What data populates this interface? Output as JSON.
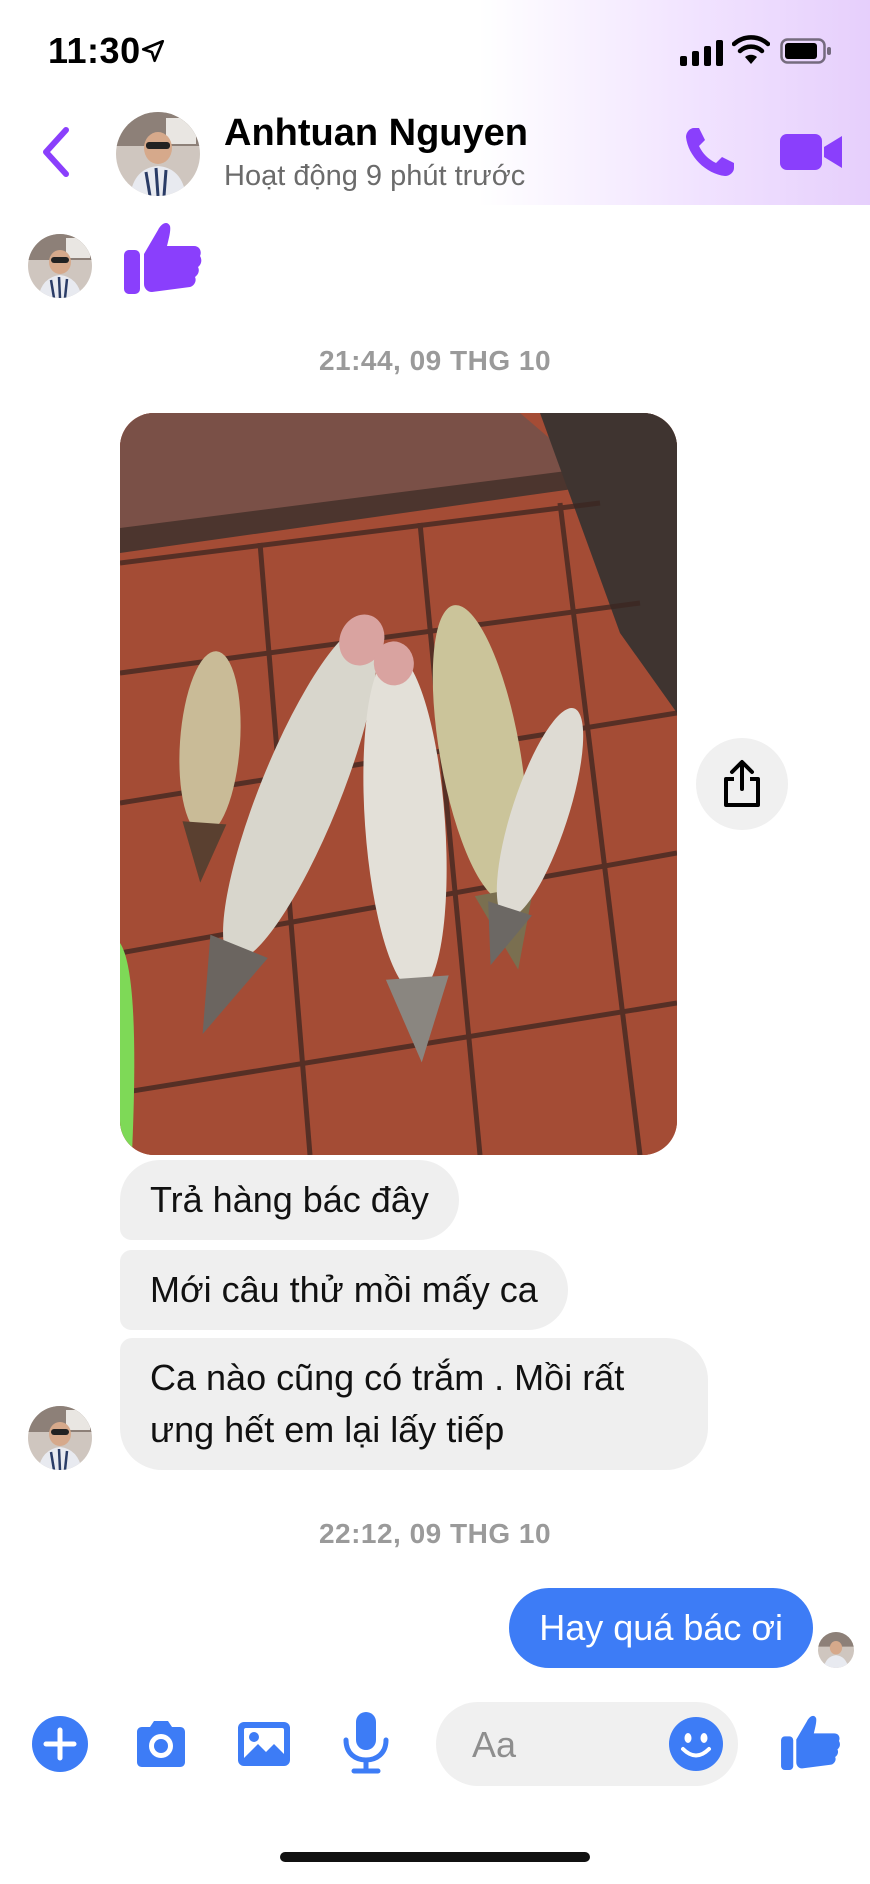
{
  "status_bar": {
    "time": "11:30"
  },
  "header": {
    "name": "Anhtuan Nguyen",
    "status": "Hoạt động 9 phút trước"
  },
  "messages": {
    "timestamp_1": "21:44, 09 THG 10",
    "incoming": [
      "Trả hàng bác đây",
      "Mới câu thử mồi mấy ca",
      "Ca nào cũng có trắm . Mồi rất ưng hết em lại lấy tiếp"
    ],
    "timestamp_2": "22:12, 09 THG 10",
    "outgoing": [
      "Hay quá bác ơi"
    ]
  },
  "composer": {
    "placeholder": "Aa"
  },
  "icons": {
    "back": "chevron-left-icon",
    "call": "phone-icon",
    "video": "video-camera-icon",
    "like": "thumbs-up-icon",
    "share": "share-icon",
    "add": "plus-icon",
    "camera": "camera-icon",
    "gallery": "image-icon",
    "mic": "microphone-icon",
    "emoji": "emoji-icon"
  },
  "colors": {
    "accent_purple": "#8a3ffc",
    "accent_blue": "#3d7cf6",
    "bubble_incoming": "#efefef"
  }
}
